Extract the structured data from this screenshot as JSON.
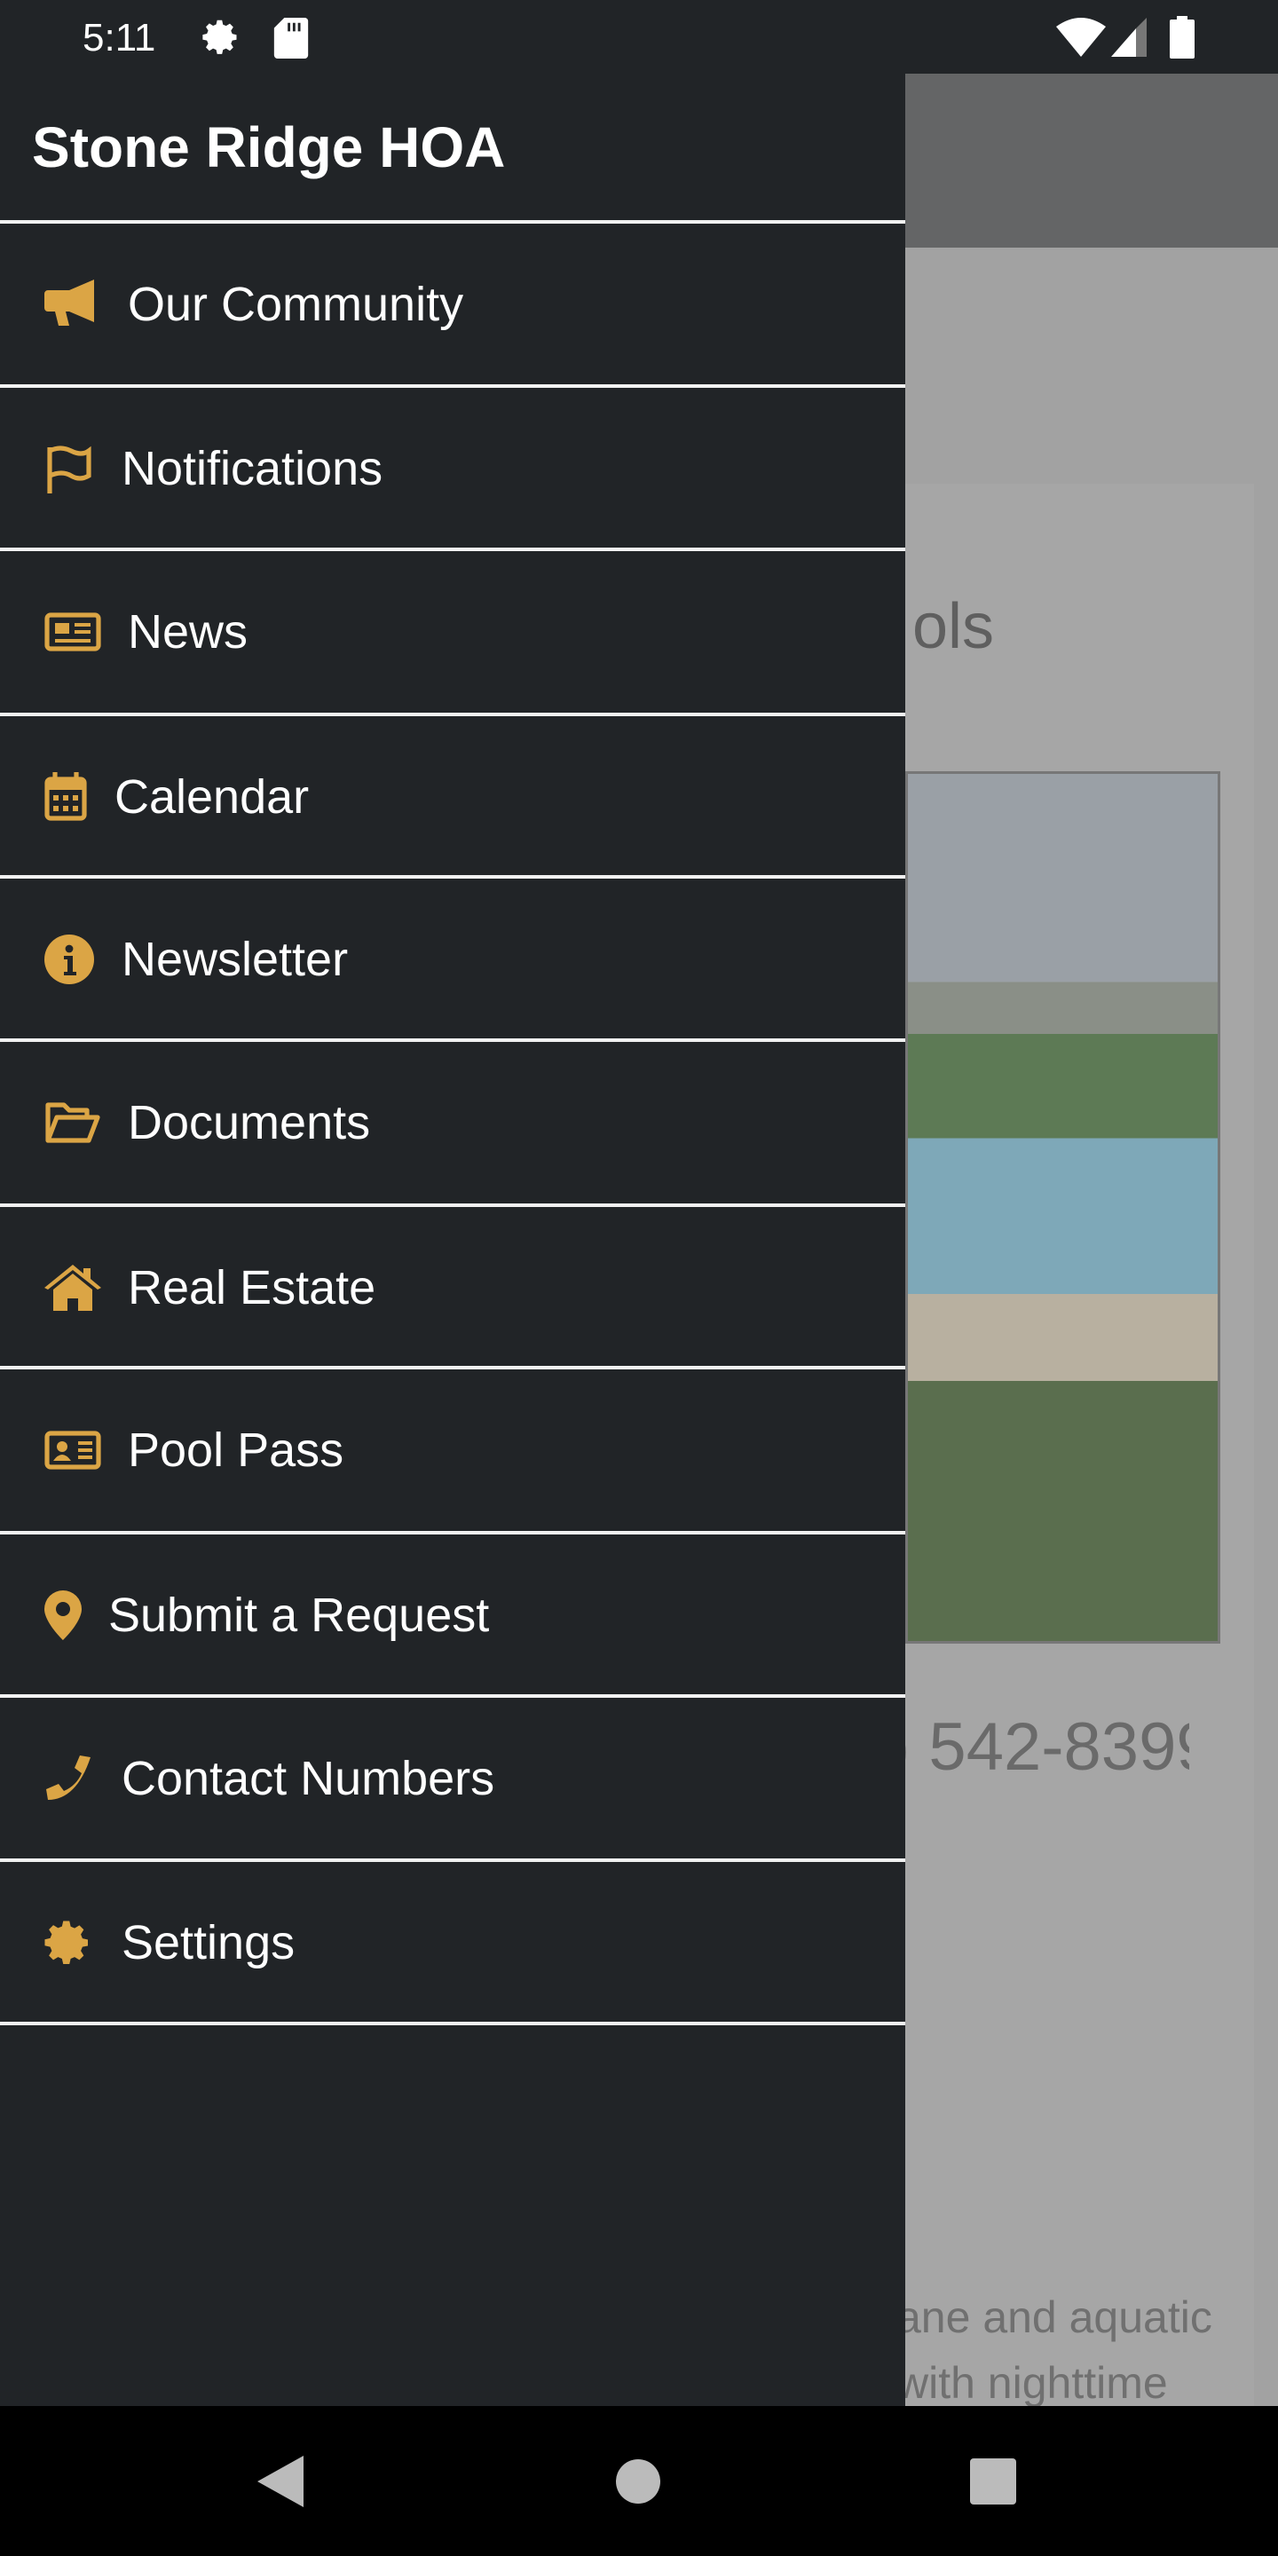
{
  "status_bar": {
    "time": "5:11",
    "icons": [
      "gear-icon",
      "sd-card-icon",
      "wifi-icon",
      "signal-icon",
      "battery-icon"
    ]
  },
  "drawer": {
    "title": "Stone Ridge HOA",
    "accent_color": "#dba545",
    "items": [
      {
        "label": "Our Community",
        "icon": "megaphone-icon"
      },
      {
        "label": "Notifications",
        "icon": "flag-icon"
      },
      {
        "label": "News",
        "icon": "newspaper-icon"
      },
      {
        "label": "Calendar",
        "icon": "calendar-icon"
      },
      {
        "label": "Newsletter",
        "icon": "info-circle-icon"
      },
      {
        "label": "Documents",
        "icon": "folder-open-icon"
      },
      {
        "label": "Real Estate",
        "icon": "home-icon"
      },
      {
        "label": "Pool Pass",
        "icon": "id-card-icon"
      },
      {
        "label": "Submit a Request",
        "icon": "map-pin-icon"
      },
      {
        "label": "Contact Numbers",
        "icon": "phone-icon"
      },
      {
        "label": "Settings",
        "icon": "cog-icon"
      }
    ]
  },
  "background": {
    "title_fragment": "ols",
    "phone_fragment": ") 542-8399",
    "text_line1": "ane and aquatic",
    "text_line2": "with nighttime"
  },
  "nav_bar": {
    "icons": [
      "back-icon",
      "home-circle-icon",
      "recents-icon"
    ]
  }
}
